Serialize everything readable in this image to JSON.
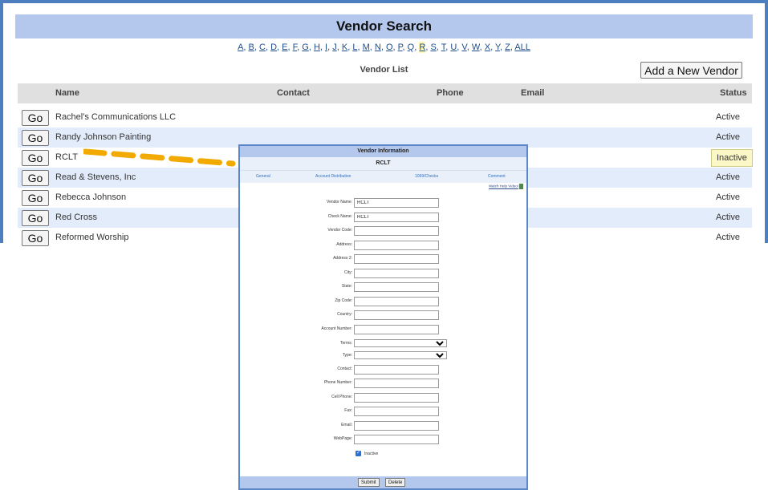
{
  "header": {
    "title": "Vendor Search"
  },
  "alpha_nav": {
    "letters": [
      "A",
      "B",
      "C",
      "D",
      "E",
      "F",
      "G",
      "H",
      "I",
      "J",
      "K",
      "L",
      "M",
      "N",
      "O",
      "P",
      "Q",
      "R",
      "S",
      "T",
      "U",
      "V",
      "W",
      "X",
      "Y",
      "Z",
      "ALL"
    ],
    "active": "R"
  },
  "list": {
    "label": "Vendor List",
    "add_button_label": "Add a New Vendor",
    "columns": {
      "name": "Name",
      "contact": "Contact",
      "phone": "Phone",
      "email": "Email",
      "status": "Status"
    },
    "go_label": "Go",
    "rows": [
      {
        "name": "Rachel's Communications LLC",
        "status": "Active"
      },
      {
        "name": "Randy Johnson Painting",
        "status": "Active"
      },
      {
        "name": "RCLT",
        "status": "Inactive"
      },
      {
        "name": "Read & Stevens, Inc",
        "status": "Active"
      },
      {
        "name": "Rebecca Johnson",
        "status": "Active"
      },
      {
        "name": "Red Cross",
        "status": "Active"
      },
      {
        "name": "Reformed Worship",
        "status": "Active"
      }
    ],
    "highlight_color": "#fbf7c6"
  },
  "callout": {
    "color": "#f2a900"
  },
  "popup": {
    "title": "Vendor Information",
    "subtitle": "RCLT",
    "tabs": [
      "General",
      "Account Distribution",
      "1099/Checks",
      "Comment"
    ],
    "help_link": "Watch Help Video!",
    "fields": [
      {
        "label": "Vendor Name:",
        "value": "RCLT",
        "type": "text"
      },
      {
        "label": "Check Name:",
        "value": "RCLT",
        "type": "text"
      },
      {
        "label": "Vendor Code:",
        "value": "",
        "type": "text"
      },
      {
        "label": "Address:",
        "value": "",
        "type": "text"
      },
      {
        "label": "Address 2:",
        "value": "",
        "type": "text"
      },
      {
        "label": "City:",
        "value": "",
        "type": "text"
      },
      {
        "label": "State:",
        "value": "",
        "type": "text"
      },
      {
        "label": "Zip Code:",
        "value": "",
        "type": "text"
      },
      {
        "label": "Country:",
        "value": "",
        "type": "text"
      },
      {
        "label": "Account Number:",
        "value": "",
        "type": "text"
      },
      {
        "label": "Terms:",
        "value": "",
        "type": "select"
      },
      {
        "label": "Type:",
        "value": "",
        "type": "select"
      },
      {
        "label": "Contact:",
        "value": "",
        "type": "text"
      },
      {
        "label": "Phone Number:",
        "value": "",
        "type": "text"
      },
      {
        "label": "Cell Phone:",
        "value": "",
        "type": "text"
      },
      {
        "label": "Fax:",
        "value": "",
        "type": "text"
      },
      {
        "label": "Email:",
        "value": "",
        "type": "text"
      },
      {
        "label": "WebPage:",
        "value": "",
        "type": "text"
      }
    ],
    "inactive_label": "Inactive",
    "inactive_checked": true,
    "submit_label": "Submit",
    "delete_label": "Delete"
  }
}
